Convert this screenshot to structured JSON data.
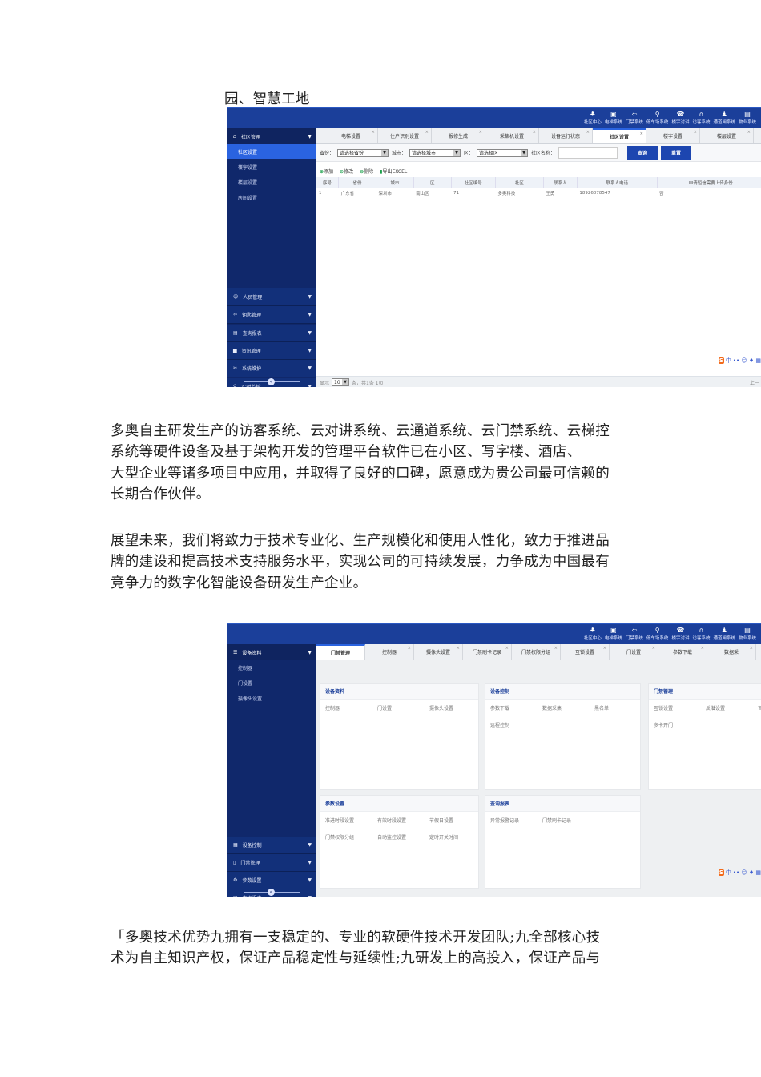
{
  "doc": {
    "heading_fragment": "园、智慧工地",
    "para1": [
      "多奥自主研发生产的访客系统、云对讲系统、云通道系统、云门禁系统、云梯控",
      "系统等硬件设备及基于架构开发的管理平台软件已在小区、写字楼、酒店、",
      "大型企业等诸多项目中应用，并取得了良好的口碑，愿意成为贵公司最可信赖的",
      "长期合作伙伴。"
    ],
    "para2": [
      "展望未来，我们将致力于技术专业化、生产规模化和使用人性化，致力于推进品",
      "牌的建设和提高技术支持服务水平，实现公司的可持续发展，力争成为中国最有",
      "竞争力的数字化智能设备研发生产企业。"
    ],
    "para3": [
      "「多奥技术优势九拥有一支稳定的、专业的软硬件技术开发团队;九全部核心技",
      "术为自主知识产权，保证产品稳定性与延续性;九研发上的高投入，保证产品与"
    ]
  },
  "sys_nav": [
    "社区中心",
    "电梯系统",
    "门禁系统",
    "停车场系统",
    "楼宇对讲",
    "访客系统",
    "通道闸系统",
    "物业系统"
  ],
  "shot1": {
    "side_header": "社区管理",
    "side_items": [
      "社区设置",
      "楼宇设置",
      "楼层设置",
      "房间设置"
    ],
    "groups": [
      "人员管理",
      "钥匙管理",
      "查询报表",
      "资讯管理",
      "系统维护",
      "实时监控"
    ],
    "tabs": [
      "电梯设置",
      "住户识别设置",
      "报修生成",
      "采集机设置",
      "设备运行状态",
      "社区设置",
      "楼宇设置",
      "楼层设置"
    ],
    "filter": {
      "province_label": "省份：",
      "province": "请选择省份",
      "city_label": "城市：",
      "city": "请选择城市",
      "district_label": "区：",
      "district": "请选择区",
      "name_label": "社区名称：",
      "query": "查询",
      "reset": "重置"
    },
    "toolbar": {
      "add": "添加",
      "edit": "修改",
      "delete": "删除",
      "export": "导出EXCEL"
    },
    "columns": [
      "序号",
      "省份",
      "城市",
      "区",
      "社区编号",
      "社区",
      "联系人",
      "联系人电话",
      "申请短信需要上传身份"
    ],
    "rows": [
      [
        "1",
        "广东省",
        "深圳市",
        "南山区",
        "71",
        "多奥科技",
        "王勇",
        "18926078547",
        "否"
      ]
    ],
    "footer": {
      "show": "显示",
      "page_size": "10",
      "summary": "条，共1条 1页",
      "prev": "上一"
    }
  },
  "shot2": {
    "side_header": "设备资料",
    "side_items": [
      "控制器",
      "门设置",
      "摄像头设置"
    ],
    "groups": [
      "设备控制",
      "门禁管理",
      "参数设置",
      "查询报表"
    ],
    "tabs": [
      "门禁管理",
      "控制器",
      "摄像头设置",
      "门禁刷卡记录",
      "门禁权限分组",
      "互锁设置",
      "门设置",
      "参数下载",
      "数据采"
    ],
    "panels": [
      {
        "title": "设备资料",
        "items": [
          "控制器",
          "门设置",
          "摄像头设置"
        ]
      },
      {
        "title": "设备控制",
        "items": [
          "参数下载",
          "数据采集",
          "黑名单",
          "远程控制"
        ]
      },
      {
        "title": "门禁管理",
        "items": [
          "互锁设置",
          "反潜设置",
          "首卡",
          "多卡开门"
        ]
      },
      {
        "title": "参数设置",
        "items": [
          "准进时段设置",
          "有效时段设置",
          "节假日设置",
          "门禁权限分组",
          "自动监控设置",
          "定时开关时间"
        ]
      },
      {
        "title": "查询报表",
        "items": [
          "异常报警记录",
          "门禁刷卡记录"
        ]
      }
    ]
  },
  "ime": {
    "logo": "S",
    "lang": "中"
  }
}
